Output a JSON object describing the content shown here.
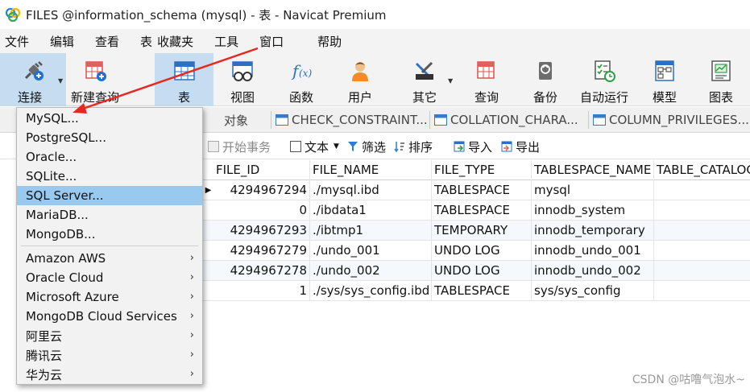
{
  "window": {
    "title": "FILES @information_schema (mysql) - 表 - Navicat Premium"
  },
  "menubar": {
    "items": [
      "文件",
      "编辑",
      "查看",
      "表",
      "收藏夹",
      "工具",
      "窗口",
      "帮助"
    ]
  },
  "toolbar": {
    "connect": "连接",
    "new_query": "新建查询",
    "table": "表",
    "view": "视图",
    "function": "函数",
    "user": "用户",
    "other": "其它",
    "query": "查询",
    "backup": "备份",
    "automation": "自动运行",
    "model": "模型",
    "chart": "图表"
  },
  "object_tabs": {
    "objects": "对象",
    "tabs": [
      "CHECK_CONSTRAINT...",
      "COLLATION_CHARA...",
      "COLUMN_PRIVILEGES..."
    ]
  },
  "data_toolbar": {
    "begin_transaction": "开始事务",
    "text": "文本",
    "filter": "筛选",
    "sort": "排序",
    "import": "导入",
    "export": "导出"
  },
  "grid": {
    "columns": [
      "FILE_ID",
      "FILE_NAME",
      "FILE_TYPE",
      "TABLESPACE_NAME",
      "TABLE_CATALOG"
    ],
    "rows": [
      [
        "4294967294",
        "./mysql.ibd",
        "TABLESPACE",
        "mysql",
        ""
      ],
      [
        "0",
        "./ibdata1",
        "TABLESPACE",
        "innodb_system",
        ""
      ],
      [
        "4294967293",
        "./ibtmp1",
        "TEMPORARY",
        "innodb_temporary",
        ""
      ],
      [
        "4294967279",
        "./undo_001",
        "UNDO LOG",
        "innodb_undo_001",
        ""
      ],
      [
        "4294967278",
        "./undo_002",
        "UNDO LOG",
        "innodb_undo_002",
        ""
      ],
      [
        "1",
        "./sys/sys_config.ibd",
        "TABLESPACE",
        "sys/sys_config",
        ""
      ]
    ]
  },
  "connect_menu": {
    "items": [
      "MySQL...",
      "PostgreSQL...",
      "Oracle...",
      "SQLite...",
      "SQL Server...",
      "MariaDB...",
      "MongoDB...",
      "Amazon AWS",
      "Oracle Cloud",
      "Microsoft Azure",
      "MongoDB Cloud Services",
      "阿里云",
      "腾讯云",
      "华为云"
    ],
    "submenu_arrow": "›"
  },
  "watermark": "CSDN @咕噜气泡水~",
  "colors": {
    "accent_arrow": "#e8281e",
    "highlight": "#99c9ef",
    "active_tool": "#c6dcf0"
  }
}
